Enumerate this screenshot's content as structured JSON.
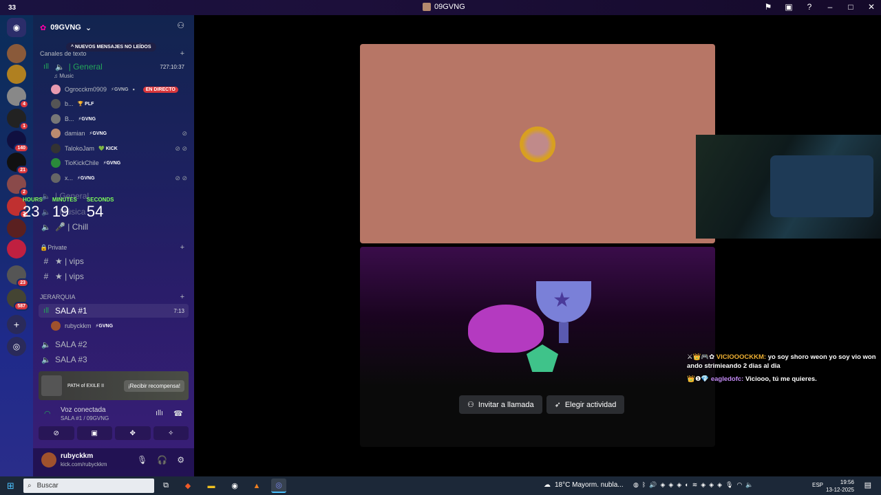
{
  "titlebar": {
    "count": "33",
    "title": "09GVNG"
  },
  "sidebar": {
    "server_name": "09GVNG",
    "unread_pill": "^ NUEVOS MENSAJES NO LEÍDOS",
    "category_text": "Canales de texto",
    "general_label": "| General",
    "general_sub": "♫ Music",
    "general_time": "727:10:37",
    "users": [
      {
        "name": "Ogrocckm0909",
        "tag": "⚡GVNG",
        "live": "EN DIRECTO"
      },
      {
        "name": "b...",
        "tag": "🏆 PLF"
      },
      {
        "name": "B...",
        "tag": "⚡GVNG"
      },
      {
        "name": "damian",
        "tag": "⚡GVNG"
      },
      {
        "name": "TalokoJam",
        "tag": "💚 KICK"
      },
      {
        "name": "TioKickChile",
        "tag": "⚡GVNG"
      },
      {
        "name": "x...",
        "tag": "⚡GVNG"
      }
    ],
    "general2": "| General",
    "musica": "| Música",
    "chill": "🎤 | Chill",
    "private_cat": "🔒Private",
    "vips1": "★ | vips",
    "vips2": "★ | vips",
    "jerarquia": "JERARQUIA",
    "sala1": "SALA #1",
    "sala1_time": "7:13",
    "sala1_user": "rubyckkm",
    "sala1_tag": "⚡GVNG",
    "sala2": "SALA #2",
    "sala3": "SALA #3"
  },
  "timer": {
    "hours_label": "HOURS",
    "minutes_label": "MINUTES",
    "seconds_label": "SECONDS",
    "hours": "23",
    "minutes": "19",
    "seconds": "54"
  },
  "promo": {
    "title": "PATH of EXILE II",
    "button": "¡Recibir recompensa!"
  },
  "voice": {
    "status": "Voz conectada",
    "channel": "SALA #1 / 09GVNG"
  },
  "userpanel": {
    "name": "rubyckkm",
    "status": "kick.com/rubyckkm"
  },
  "activity": {
    "invite": "Invitar a llamada",
    "choose": "Elegir actividad"
  },
  "chat": [
    {
      "user": "VICIOOOCKKM:",
      "text": "yo soy shoro weon yo soy vio won ando strimieando 2 dias al dia"
    },
    {
      "user": "eagledofc:",
      "text": "Viciooo, tú me quieres."
    }
  ],
  "taskbar": {
    "search": "Buscar",
    "weather": "18°C  Mayorm. nubla...",
    "lang": "ESP",
    "time": "19:56",
    "date": "13-12-2025"
  },
  "servers": [
    {
      "badge": ""
    },
    {
      "badge": ""
    },
    {
      "badge": "4"
    },
    {
      "badge": "1"
    },
    {
      "badge": "140"
    },
    {
      "badge": "21"
    },
    {
      "badge": "2"
    },
    {
      "badge": "2"
    },
    {
      "badge": ""
    },
    {
      "badge": ""
    },
    {
      "badge": "23"
    },
    {
      "badge": "587"
    }
  ]
}
